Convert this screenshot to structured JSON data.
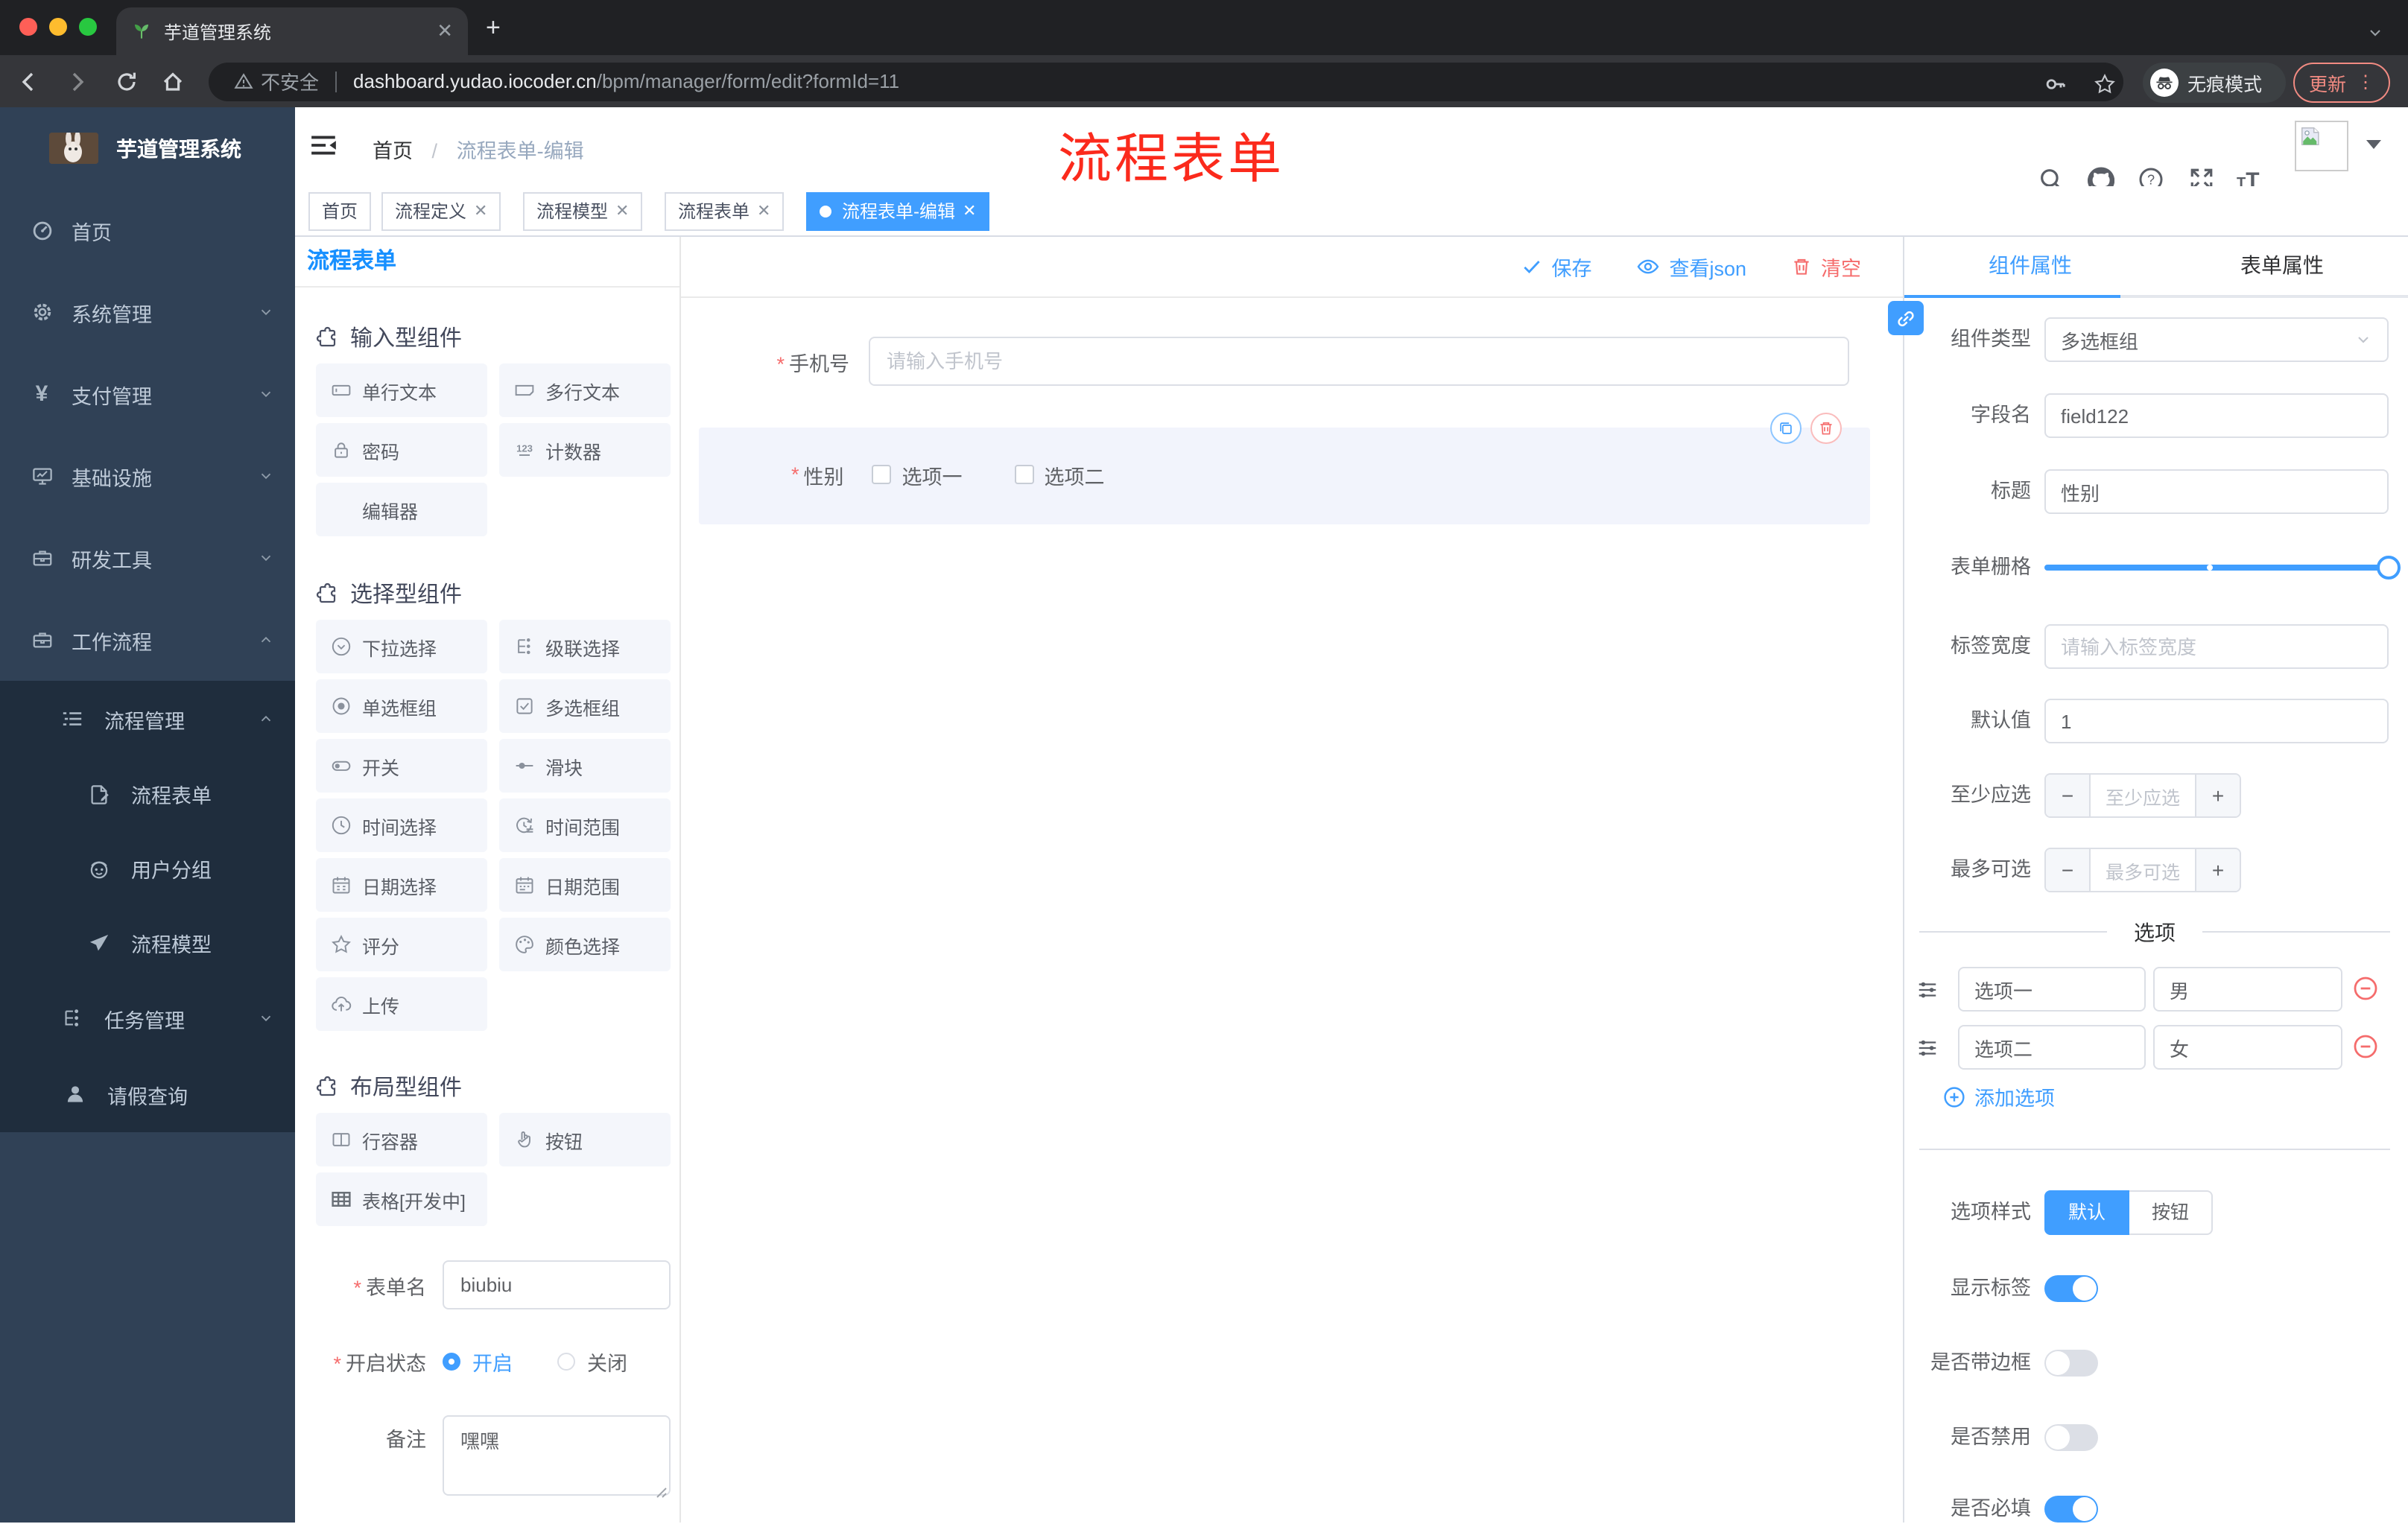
{
  "browser": {
    "tab_title": "芋道管理系统",
    "security_label": "不安全",
    "url_host": "dashboard.yudao.iocoder.cn",
    "url_path": "/bpm/manager/form/edit?formId=11",
    "incognito_label": "无痕模式",
    "update_label": "更新"
  },
  "sidebar": {
    "app_title": "芋道管理系统",
    "menu": [
      {
        "label": "首页"
      },
      {
        "label": "系统管理"
      },
      {
        "label": "支付管理"
      },
      {
        "label": "基础设施"
      },
      {
        "label": "研发工具"
      },
      {
        "label": "工作流程"
      },
      {
        "label": "流程管理"
      },
      {
        "label": "流程表单"
      },
      {
        "label": "用户分组"
      },
      {
        "label": "流程模型"
      },
      {
        "label": "任务管理"
      },
      {
        "label": "请假查询"
      }
    ]
  },
  "header": {
    "breadcrumb_home": "首页",
    "breadcrumb_current": "流程表单-编辑",
    "overlay_title": "流程表单"
  },
  "tags": [
    {
      "label": "首页"
    },
    {
      "label": "流程定义"
    },
    {
      "label": "流程模型"
    },
    {
      "label": "流程表单"
    },
    {
      "label": "流程表单-编辑"
    }
  ],
  "left_panel": {
    "title": "流程表单",
    "sections": [
      {
        "title": "输入型组件",
        "items": [
          {
            "label": "单行文本"
          },
          {
            "label": "多行文本"
          },
          {
            "label": "密码"
          },
          {
            "label": "计数器"
          },
          {
            "label": "编辑器"
          }
        ]
      },
      {
        "title": "选择型组件",
        "items": [
          {
            "label": "下拉选择"
          },
          {
            "label": "级联选择"
          },
          {
            "label": "单选框组"
          },
          {
            "label": "多选框组"
          },
          {
            "label": "开关"
          },
          {
            "label": "滑块"
          },
          {
            "label": "时间选择"
          },
          {
            "label": "时间范围"
          },
          {
            "label": "日期选择"
          },
          {
            "label": "日期范围"
          },
          {
            "label": "评分"
          },
          {
            "label": "颜色选择"
          },
          {
            "label": "上传"
          }
        ]
      },
      {
        "title": "布局型组件",
        "items": [
          {
            "label": "行容器"
          },
          {
            "label": "按钮"
          },
          {
            "label": "表格[开发中]"
          }
        ]
      }
    ],
    "form": {
      "name_label": "表单名",
      "name_value": "biubiu",
      "status_label": "开启状态",
      "status_on": "开启",
      "status_off": "关闭",
      "remark_label": "备注",
      "remark_value": "嘿嘿"
    }
  },
  "canvas": {
    "save_label": "保存",
    "view_json_label": "查看json",
    "clear_label": "清空",
    "phone_label": "手机号",
    "phone_placeholder": "请输入手机号",
    "gender_label": "性别",
    "gender_option1": "选项一",
    "gender_option2": "选项二"
  },
  "right_panel": {
    "tab_component": "组件属性",
    "tab_form": "表单属性",
    "type_label": "组件类型",
    "type_value": "多选框组",
    "field_label": "字段名",
    "field_value": "field122",
    "title_label": "标题",
    "title_value": "性别",
    "grid_label": "表单栅格",
    "label_width_label": "标签宽度",
    "label_width_placeholder": "请输入标签宽度",
    "default_label": "默认值",
    "default_value": "1",
    "min_label": "至少应选",
    "min_placeholder": "至少应选",
    "max_label": "最多可选",
    "max_placeholder": "最多可选",
    "options_title": "选项",
    "options": [
      {
        "label": "选项一",
        "value": "男"
      },
      {
        "label": "选项二",
        "value": "女"
      }
    ],
    "add_option_label": "添加选项",
    "style_label": "选项样式",
    "style_default": "默认",
    "style_button": "按钮",
    "show_label_label": "显示标签",
    "border_label": "是否带边框",
    "disabled_label": "是否禁用",
    "required_label": "是否必填"
  },
  "colors": {
    "accent": "#409eff",
    "danger": "#f56c6c",
    "sidebar_bg": "#304156",
    "submenu_bg": "#1f2d3d",
    "overlay_red": "#fb2a1c"
  }
}
